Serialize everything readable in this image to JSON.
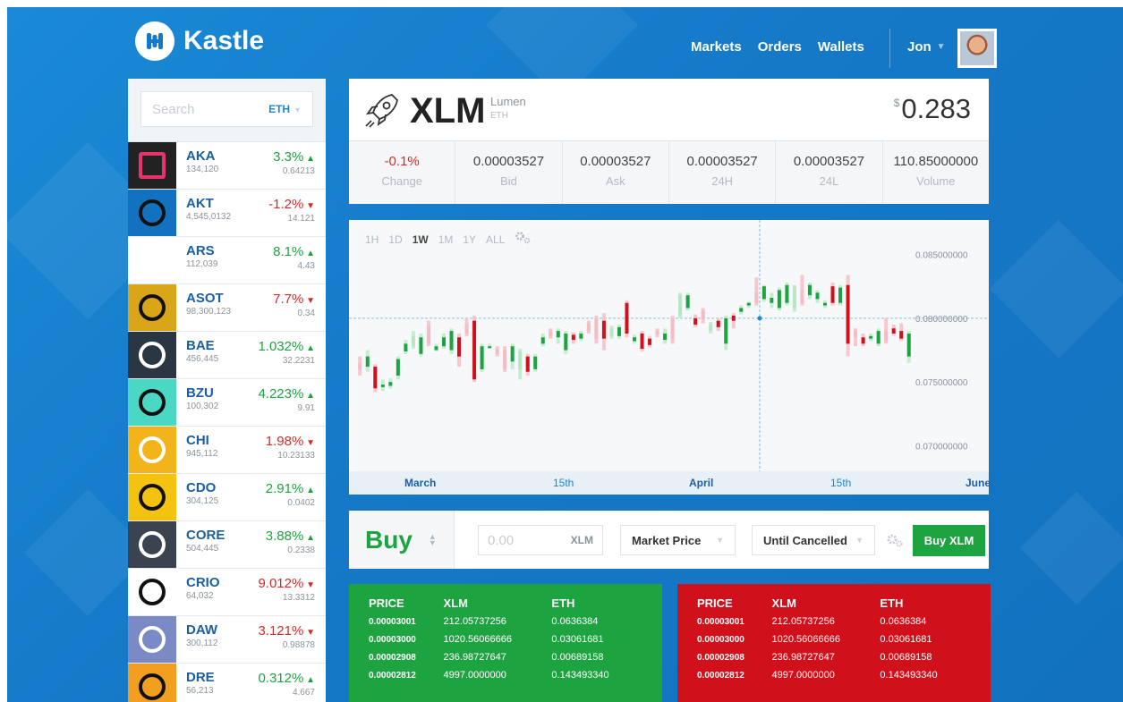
{
  "brand": {
    "name": "Kastle"
  },
  "nav": {
    "markets": "Markets",
    "orders": "Orders",
    "wallets": "Wallets",
    "user": "Jon"
  },
  "search": {
    "placeholder": "Search",
    "filter": "ETH"
  },
  "coins": [
    {
      "sym": "AKA",
      "vol": "134,120",
      "pct": "3.3%",
      "dir": "up",
      "price": "0.64213"
    },
    {
      "sym": "AKT",
      "vol": "4,545,0132",
      "pct": "-1.2%",
      "dir": "down",
      "price": "14.121"
    },
    {
      "sym": "ARS",
      "vol": "112,039",
      "pct": "8.1%",
      "dir": "up",
      "price": "4.43"
    },
    {
      "sym": "ASOT",
      "vol": "98,300,123",
      "pct": "7.7%",
      "dir": "down",
      "price": "0.34"
    },
    {
      "sym": "BAE",
      "vol": "456,445",
      "pct": "1.032%",
      "dir": "up",
      "price": "32.2231"
    },
    {
      "sym": "BZU",
      "vol": "100,302",
      "pct": "4.223%",
      "dir": "up",
      "price": "9.91"
    },
    {
      "sym": "CHI",
      "vol": "945,112",
      "pct": "1.98%",
      "dir": "down",
      "price": "10.23133"
    },
    {
      "sym": "CDO",
      "vol": "304,125",
      "pct": "2.91%",
      "dir": "up",
      "price": "0.0402"
    },
    {
      "sym": "CORE",
      "vol": "504,445",
      "pct": "3.88%",
      "dir": "up",
      "price": "0.2338"
    },
    {
      "sym": "CRIO",
      "vol": "64,032",
      "pct": "9.012%",
      "dir": "down",
      "price": "13.3312"
    },
    {
      "sym": "DAW",
      "vol": "300,112",
      "pct": "3.121%",
      "dir": "down",
      "price": "0.98878"
    },
    {
      "sym": "DRE",
      "vol": "56,213",
      "pct": "0.312%",
      "dir": "up",
      "price": "4.667"
    }
  ],
  "asset": {
    "symbol": "XLM",
    "name": "Lumen",
    "pair": "ETH",
    "currency": "$",
    "price": "0.283"
  },
  "stats": [
    {
      "value": "-0.1%",
      "label": "Change"
    },
    {
      "value": "0.00003527",
      "label": "Bid"
    },
    {
      "value": "0.00003527",
      "label": "Ask"
    },
    {
      "value": "0.00003527",
      "label": "24H"
    },
    {
      "value": "0.00003527",
      "label": "24L"
    },
    {
      "value": "110.85000000",
      "label": "Volume"
    }
  ],
  "ranges": [
    "1H",
    "1D",
    "1W",
    "1M",
    "1Y",
    "ALL"
  ],
  "active_range": "1W",
  "chart_data": {
    "type": "candlestick",
    "yticks": [
      "0.085000000",
      "0.080000000",
      "0.075000000",
      "0.070000000"
    ],
    "ylim": [
      0.068,
      0.087
    ],
    "xticks": [
      {
        "label": "March",
        "month": true
      },
      {
        "label": "15th",
        "month": false
      },
      {
        "label": "April",
        "month": true
      },
      {
        "label": "15th",
        "month": false
      },
      {
        "label": "June",
        "month": true
      }
    ],
    "crosshair": {
      "value": 0.08
    },
    "candles": [
      [
        0.0765,
        0.076,
        0.077,
        0.0755,
        "red",
        1
      ],
      [
        0.0762,
        0.077,
        0.0775,
        0.0758,
        "green",
        0
      ],
      [
        0.0745,
        0.0762,
        0.0764,
        0.0742,
        "red",
        0
      ],
      [
        0.0746,
        0.0748,
        0.0752,
        0.0743,
        "green",
        0
      ],
      [
        0.0747,
        0.075,
        0.0753,
        0.0745,
        "green",
        0
      ],
      [
        0.0755,
        0.0768,
        0.077,
        0.0752,
        "green",
        0
      ],
      [
        0.0774,
        0.078,
        0.0783,
        0.0772,
        "green",
        0
      ],
      [
        0.0778,
        0.0786,
        0.079,
        0.0776,
        "green",
        1
      ],
      [
        0.0772,
        0.0785,
        0.0788,
        0.077,
        "green",
        0
      ],
      [
        0.078,
        0.0794,
        0.0798,
        0.0778,
        "red",
        1
      ],
      [
        0.0778,
        0.0775,
        0.078,
        0.0774,
        "green",
        0
      ],
      [
        0.0778,
        0.0785,
        0.0788,
        0.0776,
        "green",
        0
      ],
      [
        0.0775,
        0.079,
        0.0792,
        0.0772,
        "green",
        0
      ],
      [
        0.0785,
        0.077,
        0.0788,
        0.0762,
        "red",
        0
      ],
      [
        0.0788,
        0.0795,
        0.08,
        0.0786,
        "red",
        1
      ],
      [
        0.0798,
        0.0752,
        0.0802,
        0.075,
        "red",
        0
      ],
      [
        0.076,
        0.0778,
        0.078,
        0.0758,
        "green",
        0
      ],
      [
        0.0778,
        0.0778,
        0.078,
        0.0776,
        "green",
        0
      ],
      [
        0.0776,
        0.0772,
        0.0778,
        0.077,
        "red",
        1
      ],
      [
        0.076,
        0.0775,
        0.0778,
        0.0758,
        "red",
        1
      ],
      [
        0.0766,
        0.0778,
        0.078,
        0.076,
        "green",
        0
      ],
      [
        0.076,
        0.0774,
        0.0776,
        0.0752,
        "green",
        1
      ],
      [
        0.077,
        0.0758,
        0.0772,
        0.0755,
        "red",
        0
      ],
      [
        0.076,
        0.077,
        0.0772,
        0.0758,
        "green",
        0
      ],
      [
        0.078,
        0.0785,
        0.0788,
        0.0778,
        "green",
        0
      ],
      [
        0.0786,
        0.079,
        0.0792,
        0.0784,
        "red",
        1
      ],
      [
        0.0785,
        0.079,
        0.0792,
        0.078,
        "green",
        0
      ],
      [
        0.0788,
        0.0775,
        0.079,
        0.0772,
        "green",
        0
      ],
      [
        0.0787,
        0.0783,
        0.0789,
        0.078,
        "red",
        0
      ],
      [
        0.0784,
        0.0788,
        0.079,
        0.0782,
        "green",
        0
      ],
      [
        0.079,
        0.0796,
        0.0798,
        0.0788,
        "red",
        1
      ],
      [
        0.0784,
        0.08,
        0.0802,
        0.078,
        "red",
        1
      ],
      [
        0.0798,
        0.0784,
        0.0804,
        0.0775,
        "red",
        0
      ],
      [
        0.0786,
        0.0792,
        0.0794,
        0.0784,
        "green",
        1
      ],
      [
        0.0793,
        0.0786,
        0.0795,
        0.0784,
        "green",
        0
      ],
      [
        0.0812,
        0.0788,
        0.0814,
        0.0785,
        "red",
        0
      ],
      [
        0.0782,
        0.0785,
        0.0787,
        0.078,
        "green",
        0
      ],
      [
        0.0788,
        0.0776,
        0.079,
        0.0774,
        "red",
        0
      ],
      [
        0.0779,
        0.0784,
        0.0786,
        0.0777,
        "red",
        0
      ],
      [
        0.0787,
        0.079,
        0.0792,
        0.0785,
        "red",
        1
      ],
      [
        0.0783,
        0.0788,
        0.0792,
        0.078,
        "green",
        0
      ],
      [
        0.0784,
        0.08,
        0.0802,
        0.078,
        "red",
        1
      ],
      [
        0.0802,
        0.0818,
        0.082,
        0.08,
        "green",
        1
      ],
      [
        0.0808,
        0.0818,
        0.082,
        0.0806,
        "green",
        0
      ],
      [
        0.08,
        0.0795,
        0.0803,
        0.0793,
        "red",
        0
      ],
      [
        0.0806,
        0.0799,
        0.0808,
        0.0796,
        "red",
        1
      ],
      [
        0.0795,
        0.079,
        0.0797,
        0.0788,
        "green",
        1
      ],
      [
        0.0798,
        0.0793,
        0.08,
        0.079,
        "red",
        0
      ],
      [
        0.078,
        0.08,
        0.0802,
        0.0775,
        "green",
        0
      ],
      [
        0.0798,
        0.0802,
        0.0804,
        0.0792,
        "red",
        0
      ],
      [
        0.0805,
        0.0808,
        0.081,
        0.0803,
        "green",
        0
      ],
      [
        0.081,
        0.0812,
        0.0813,
        0.0808,
        "green",
        0
      ],
      [
        0.0812,
        0.082,
        0.0832,
        0.081,
        "red",
        1
      ],
      [
        0.0815,
        0.0825,
        0.0826,
        0.0813,
        "green",
        0
      ],
      [
        0.0812,
        0.0816,
        0.082,
        0.0808,
        "green",
        0
      ],
      [
        0.0808,
        0.0822,
        0.0824,
        0.0806,
        "green",
        0
      ],
      [
        0.0812,
        0.0826,
        0.0828,
        0.081,
        "green",
        0
      ],
      [
        0.0808,
        0.0825,
        0.0826,
        0.0805,
        "green",
        1
      ],
      [
        0.0822,
        0.0812,
        0.0834,
        0.081,
        "red",
        1
      ],
      [
        0.0818,
        0.0826,
        0.0828,
        0.0815,
        "green",
        0
      ],
      [
        0.082,
        0.0815,
        0.0822,
        0.0812,
        "green",
        0
      ],
      [
        0.0812,
        0.081,
        0.0814,
        0.0808,
        "green",
        0
      ],
      [
        0.0825,
        0.0812,
        0.0828,
        0.081,
        "red",
        0
      ],
      [
        0.0824,
        0.0812,
        0.0826,
        0.081,
        "green",
        0
      ],
      [
        0.0826,
        0.078,
        0.0834,
        0.077,
        "red",
        0
      ],
      [
        0.079,
        0.0785,
        0.0792,
        0.0778,
        "red",
        1
      ],
      [
        0.0785,
        0.078,
        0.0788,
        0.0778,
        "red",
        0
      ],
      [
        0.0784,
        0.0786,
        0.0788,
        0.0782,
        "green",
        0
      ],
      [
        0.078,
        0.079,
        0.0792,
        0.0778,
        "green",
        0
      ],
      [
        0.079,
        0.0782,
        0.08,
        0.078,
        "red",
        1
      ],
      [
        0.0792,
        0.0788,
        0.0795,
        0.0786,
        "red",
        0
      ],
      [
        0.079,
        0.0784,
        0.0796,
        0.0782,
        "red",
        0
      ],
      [
        0.0788,
        0.077,
        0.079,
        0.0765,
        "green",
        0
      ]
    ]
  },
  "order": {
    "side": "Buy",
    "amount_placeholder": "0.00",
    "amount_unit": "XLM",
    "price_type": "Market Price",
    "duration": "Until Cancelled",
    "submit": "Buy XLM"
  },
  "order_book": {
    "headers": [
      "PRICE",
      "XLM",
      "ETH"
    ],
    "buy_rows": [
      [
        "0.00003001",
        "212.05737256",
        "0.0636384"
      ],
      [
        "0.00003000",
        "1020.56066666",
        "0.03061681"
      ],
      [
        "0.00002908",
        "236.98727647",
        "0.00689158"
      ],
      [
        "0.00002812",
        "4997.0000000",
        "0.143493340"
      ]
    ],
    "sell_rows": [
      [
        "0.00003001",
        "212.05737256",
        "0.0636384"
      ],
      [
        "0.00003000",
        "1020.56066666",
        "0.03061681"
      ],
      [
        "0.00002908",
        "236.98727647",
        "0.00689158"
      ],
      [
        "0.00002812",
        "4997.0000000",
        "0.143493340"
      ]
    ]
  }
}
